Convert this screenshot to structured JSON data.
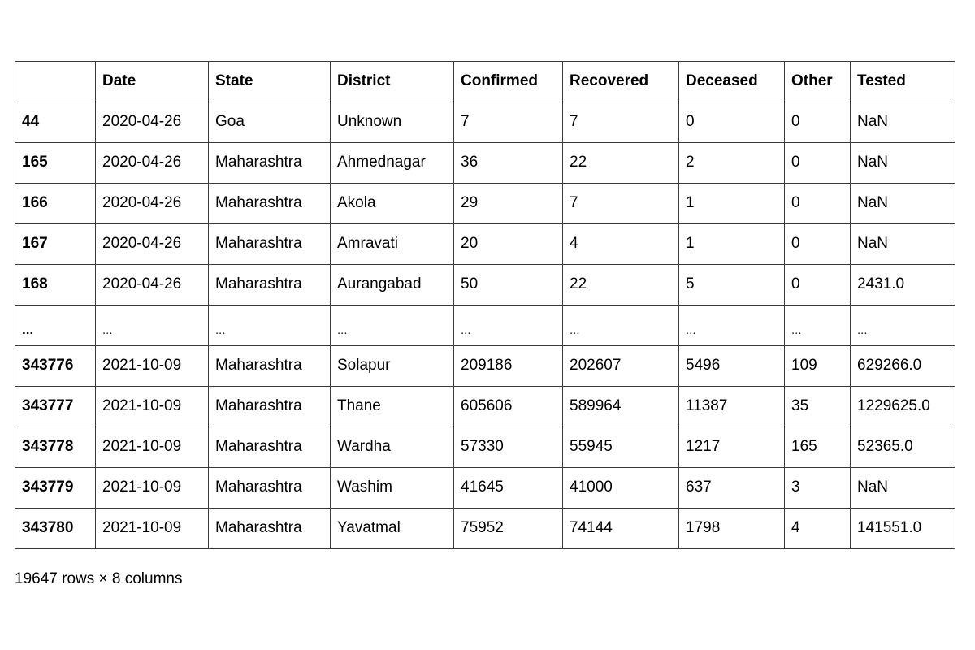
{
  "table": {
    "index_header": "",
    "columns": [
      "Date",
      "State",
      "District",
      "Confirmed",
      "Recovered",
      "Deceased",
      "Other",
      "Tested"
    ],
    "rows": [
      {
        "index": "44",
        "cells": [
          "2020-04-26",
          "Goa",
          "Unknown",
          "7",
          "7",
          "0",
          "0",
          "NaN"
        ]
      },
      {
        "index": "165",
        "cells": [
          "2020-04-26",
          "Maharashtra",
          "Ahmednagar",
          "36",
          "22",
          "2",
          "0",
          "NaN"
        ]
      },
      {
        "index": "166",
        "cells": [
          "2020-04-26",
          "Maharashtra",
          "Akola",
          "29",
          "7",
          "1",
          "0",
          "NaN"
        ]
      },
      {
        "index": "167",
        "cells": [
          "2020-04-26",
          "Maharashtra",
          "Amravati",
          "20",
          "4",
          "1",
          "0",
          "NaN"
        ]
      },
      {
        "index": "168",
        "cells": [
          "2020-04-26",
          "Maharashtra",
          "Aurangabad",
          "50",
          "22",
          "5",
          "0",
          "2431.0"
        ]
      },
      {
        "index": "...",
        "cells": [
          "...",
          "...",
          "...",
          "...",
          "...",
          "...",
          "...",
          "..."
        ]
      },
      {
        "index": "343776",
        "cells": [
          "2021-10-09",
          "Maharashtra",
          "Solapur",
          "209186",
          "202607",
          "5496",
          "109",
          "629266.0"
        ]
      },
      {
        "index": "343777",
        "cells": [
          "2021-10-09",
          "Maharashtra",
          "Thane",
          "605606",
          "589964",
          "11387",
          "35",
          "1229625.0"
        ]
      },
      {
        "index": "343778",
        "cells": [
          "2021-10-09",
          "Maharashtra",
          "Wardha",
          "57330",
          "55945",
          "1217",
          "165",
          "52365.0"
        ]
      },
      {
        "index": "343779",
        "cells": [
          "2021-10-09",
          "Maharashtra",
          "Washim",
          "41645",
          "41000",
          "637",
          "3",
          "NaN"
        ]
      },
      {
        "index": "343780",
        "cells": [
          "2021-10-09",
          "Maharashtra",
          "Yavatmal",
          "75952",
          "74144",
          "1798",
          "4",
          "141551.0"
        ]
      }
    ],
    "shape_caption": "19647 rows × 8 columns"
  },
  "colors": {
    "border": "#3a3a3a",
    "text": "#000000",
    "background": "#ffffff"
  }
}
